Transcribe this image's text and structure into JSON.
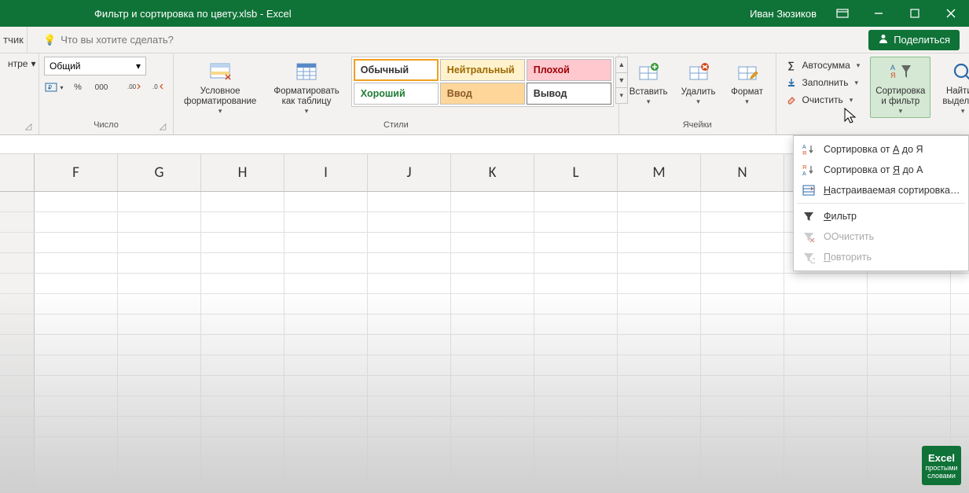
{
  "titlebar": {
    "filename": "Фильтр и сортировка по цвету.xlsb  -  Excel",
    "user": "Иван Зюзиков"
  },
  "tellbar": {
    "stub": "тчик",
    "placeholder": "Что вы хотите сделать?",
    "share": "Поделиться"
  },
  "ribbon": {
    "alignment": {
      "merge_label": "нтре",
      "group_label": ""
    },
    "number": {
      "format": "Общий",
      "group_label": "Число"
    },
    "styles": {
      "cond_format": "Условное\nформатирование",
      "table_format": "Форматировать\nкак таблицу",
      "swatches": {
        "normal": {
          "label": "Обычный",
          "color": "#333333",
          "bg": "#ffffff"
        },
        "neutral": {
          "label": "Нейтральный",
          "color": "#9c6a00",
          "bg": "#fff2cc"
        },
        "bad": {
          "label": "Плохой",
          "color": "#9c0006",
          "bg": "#ffc7ce"
        },
        "good": {
          "label": "Хороший",
          "color": "#1e7b34",
          "bg": "#ffffff"
        },
        "input": {
          "label": "Ввод",
          "color": "#8a5a2a",
          "bg": "#ffd699"
        },
        "output": {
          "label": "Вывод",
          "color": "#333333",
          "bg": "#ffffff"
        }
      },
      "group_label": "Стили"
    },
    "cells": {
      "insert": "Вставить",
      "delete": "Удалить",
      "format": "Формат",
      "group_label": "Ячейки"
    },
    "editing": {
      "autosum": "Автосумма",
      "fill": "Заполнить",
      "clear": "Очистить",
      "sort_filter": "Сортировка\nи фильтр",
      "find_select": "Найти и\nвыделить"
    }
  },
  "dropdown": {
    "sort_az": "Сортировка от А до Я",
    "sort_za": "Сортировка от Я до А",
    "custom_sort": "Настраиваемая сортировка…",
    "filter": "Фильтр",
    "clear": "Очистить",
    "reapply": "Повторить",
    "u": {
      "a": "А",
      "ya": "Я",
      "n": "Н",
      "f": "Ф",
      "o": "О",
      "p": "П"
    }
  },
  "columns": [
    "F",
    "G",
    "H",
    "I",
    "J",
    "K",
    "L",
    "M",
    "N"
  ],
  "watermark": {
    "big": "Excel",
    "small1": "простыми",
    "small2": "словами"
  }
}
